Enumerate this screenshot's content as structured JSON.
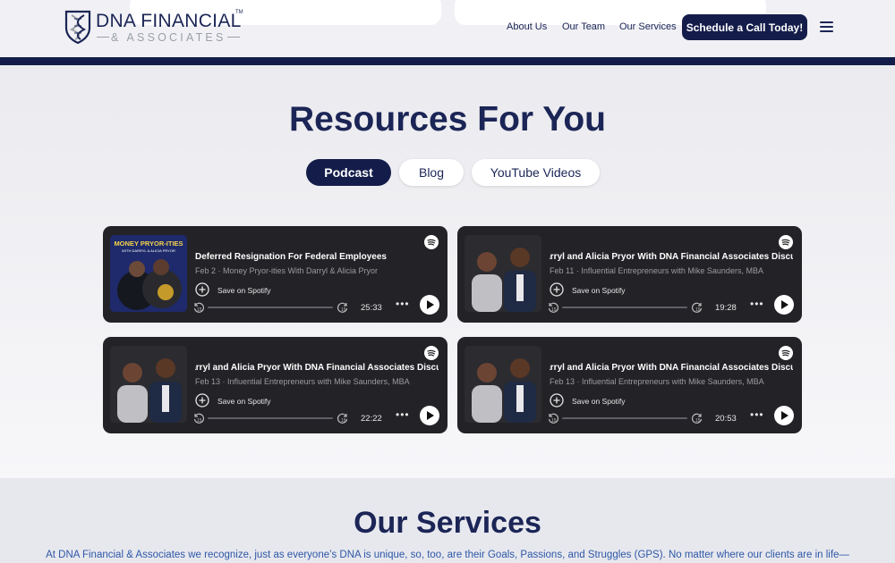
{
  "header": {
    "logo": {
      "top": "DNA FINANCIAL",
      "tm": "TM",
      "bottom": "& ASSOCIATES"
    },
    "nav": [
      "About Us",
      "Our Team",
      "Our Services"
    ],
    "cta": "Schedule a Call Today!",
    "menu_icon": "hamburger-menu-icon"
  },
  "resources": {
    "title": "Resources For You",
    "tabs": [
      {
        "label": "Podcast",
        "active": true
      },
      {
        "label": "Blog",
        "active": false
      },
      {
        "label": "YouTube Videos",
        "active": false
      }
    ]
  },
  "podcasts": [
    {
      "title": "Deferred Resignation For Federal Employees",
      "meta": "Feb 2 · Money Pryor-ities With Darryl & Alicia Pryor",
      "save": "Save on Spotify",
      "duration": "25:33",
      "thumb_text": "MONEY PRYOR-ITIES",
      "thumb_sub": "WITH DARRYL & ALICIA PRYOR",
      "progress": 0
    },
    {
      "title": "Darryl and Alicia Pryor With DNA Financial Associates Discussing",
      "meta": "Feb 11 · Influential Entrepreneurs with Mike Saunders, MBA",
      "save": "Save on Spotify",
      "duration": "19:28",
      "progress": 0
    },
    {
      "title": "Darryl and Alicia Pryor With DNA Financial Associates Discussing",
      "meta": "Feb 13 · Influential Entrepreneurs with Mike Saunders, MBA",
      "save": "Save on Spotify",
      "duration": "22:22",
      "progress": 0
    },
    {
      "title": "Darryl and Alicia Pryor With DNA Financial Associates Discussing",
      "meta": "Feb 13 · Influential Entrepreneurs with Mike Saunders, MBA",
      "save": "Save on Spotify",
      "duration": "20:53",
      "progress": 0
    }
  ],
  "services": {
    "title": "Our Services",
    "text": "At DNA Financial & Associates we recognize, just as everyone’s DNA is unique, so, too, are their Goals, Passions, and Struggles (GPS). No matter where our clients are in life—"
  },
  "colors": {
    "navy": "#141d4a",
    "card": "#232327",
    "accent_text": "#2e57a6"
  }
}
